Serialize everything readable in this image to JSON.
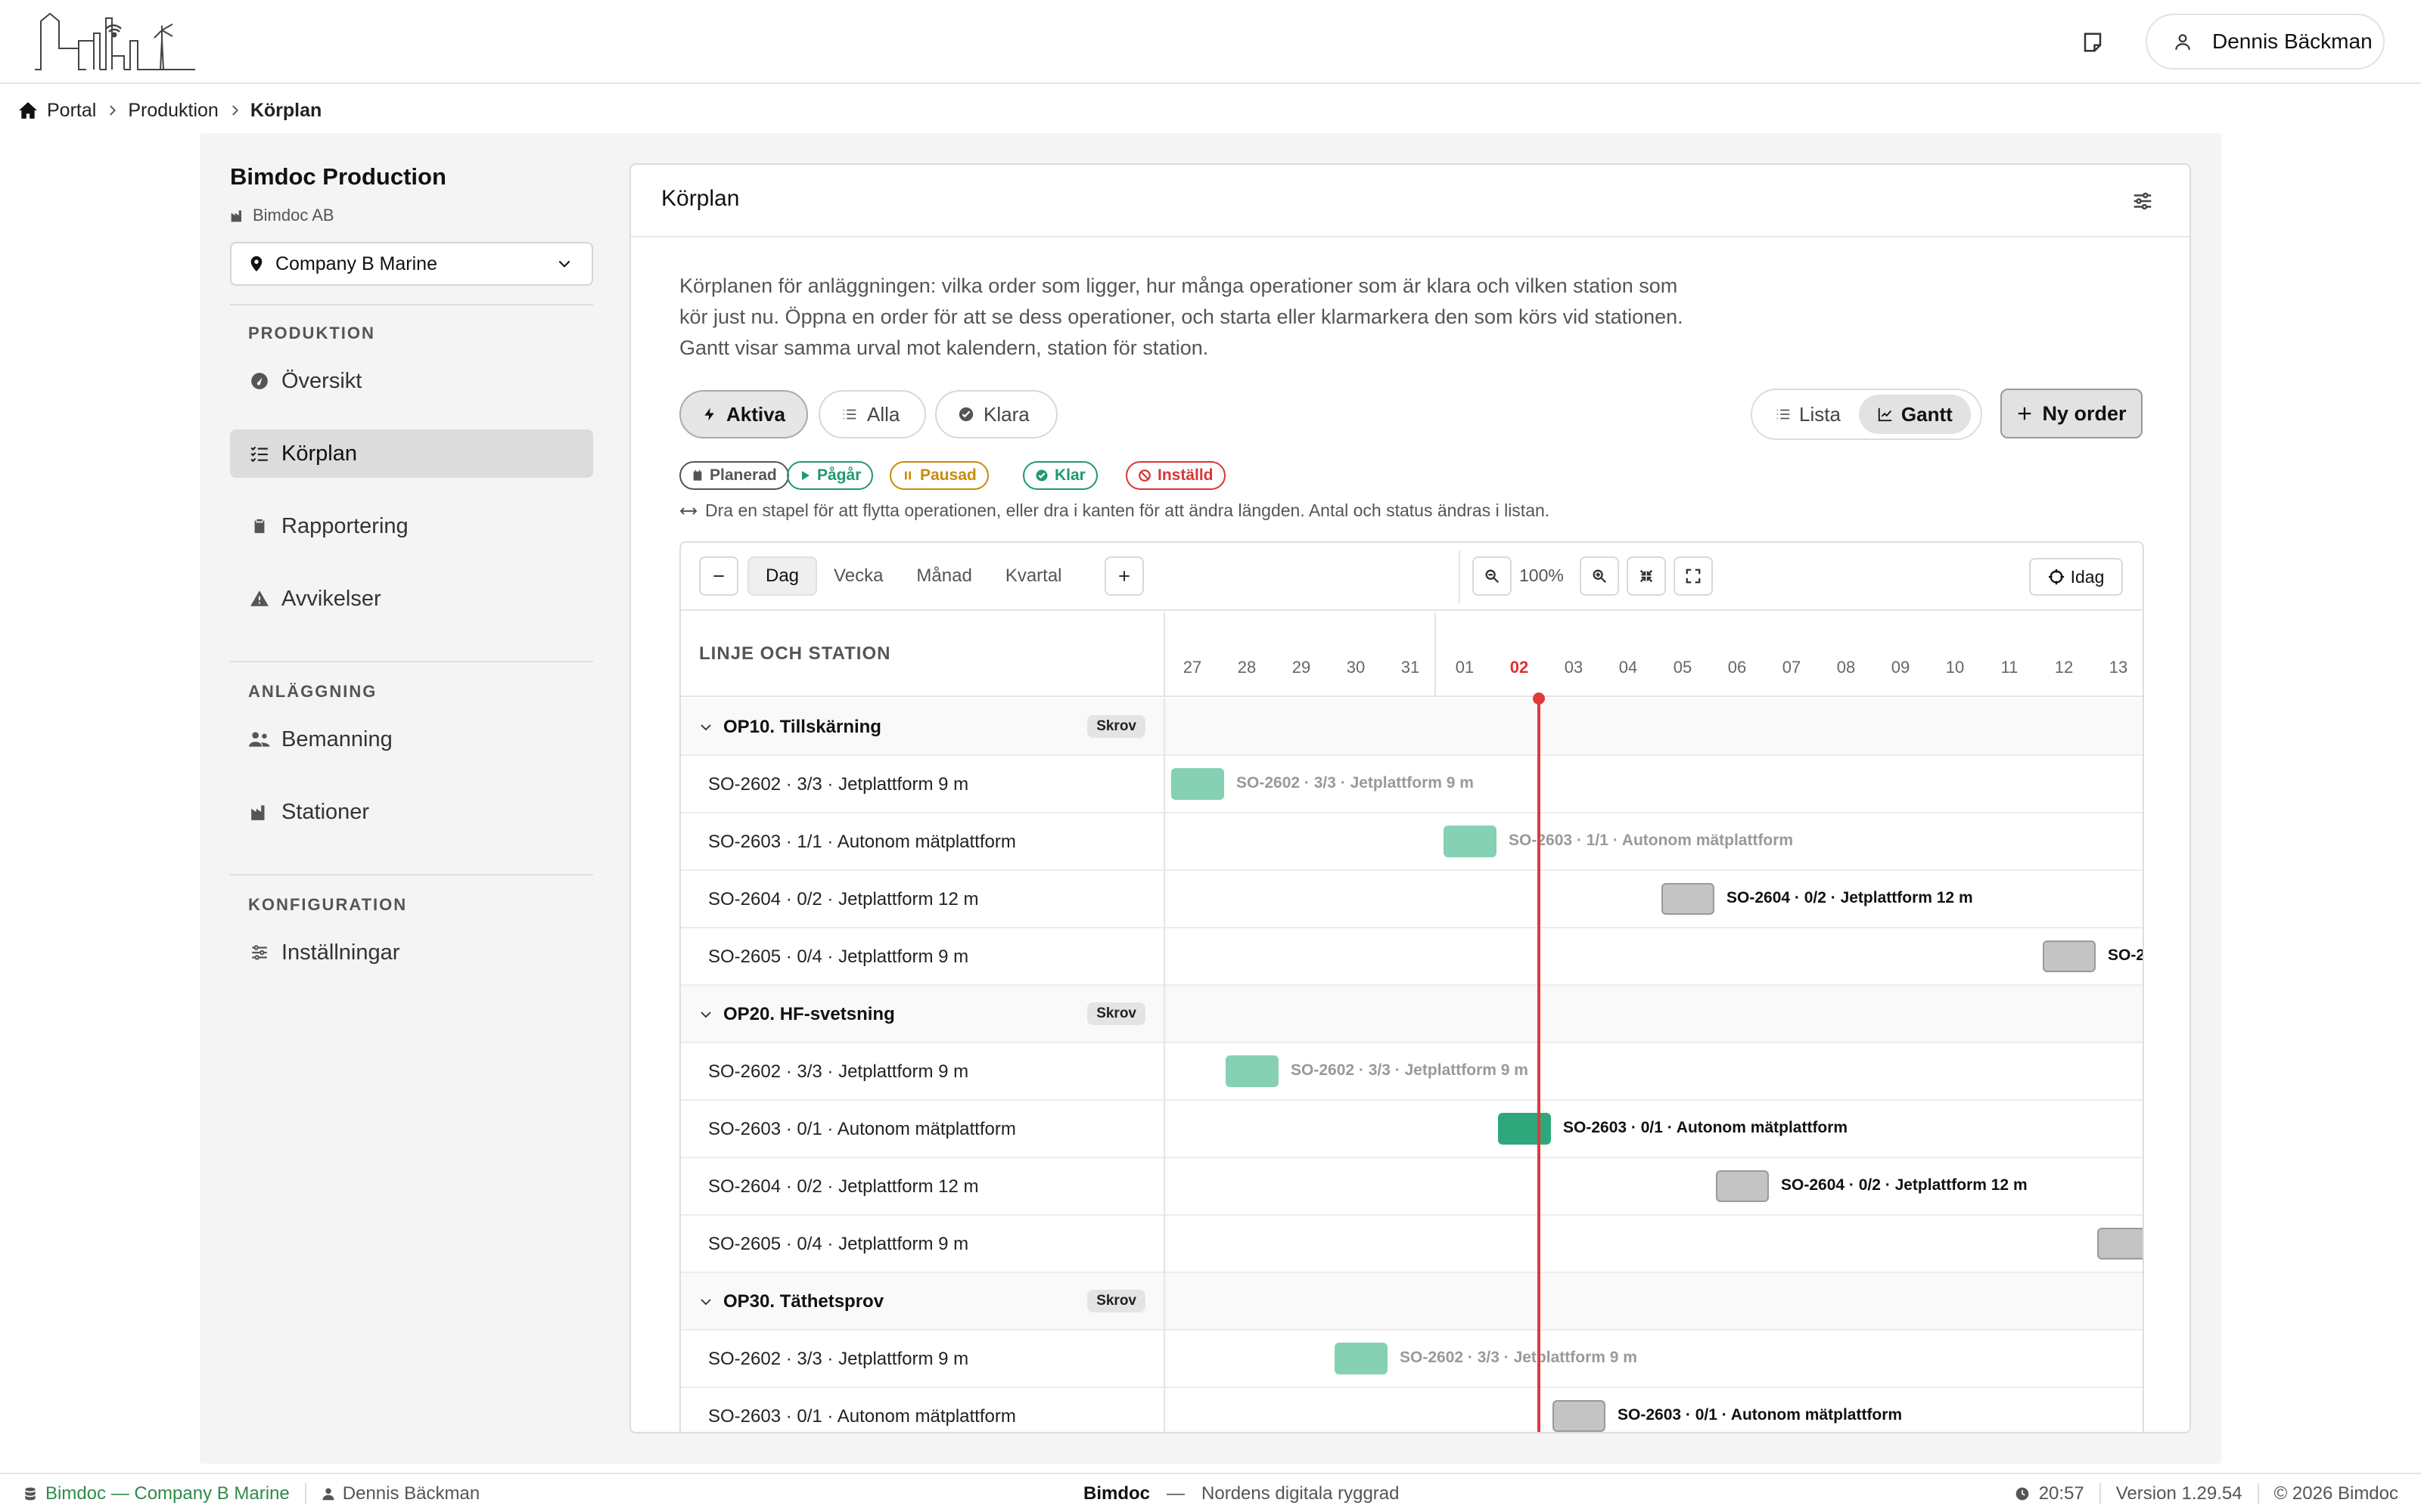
{
  "header": {
    "user_name": "Dennis Bäckman"
  },
  "breadcrumb": {
    "items": [
      "Portal",
      "Produktion",
      "Körplan"
    ]
  },
  "sidebar": {
    "org_title": "Bimdoc Production",
    "org_company": "Bimdoc AB",
    "site_selected": "Company B Marine",
    "sections": [
      {
        "label": "PRODUKTION",
        "items": [
          "Översikt",
          "Körplan",
          "Rapportering",
          "Avvikelser"
        ]
      },
      {
        "label": "ANLÄGGNING",
        "items": [
          "Bemanning",
          "Stationer"
        ]
      },
      {
        "label": "KONFIGURATION",
        "items": [
          "Inställningar"
        ]
      }
    ],
    "active_item": "Körplan"
  },
  "panel": {
    "title": "Körplan",
    "description": "Körplanen för anläggningen: vilka order som ligger, hur många operationer som är klara och vilken station som kör just nu. Öppna en order för att se dess operationer, och starta eller klarmarkera den som körs vid stationen. Gantt visar samma urval mot kalendern, station för station.",
    "filters": [
      "Aktiva",
      "Alla",
      "Klara"
    ],
    "active_filter": "Aktiva",
    "views": [
      "Lista",
      "Gantt"
    ],
    "active_view": "Gantt",
    "new_order_label": "Ny order",
    "legend": [
      {
        "label": "Planerad",
        "color": "#555555"
      },
      {
        "label": "Pågår",
        "color": "#1f9a6c"
      },
      {
        "label": "Pausad",
        "color": "#c98a0b"
      },
      {
        "label": "Klar",
        "color": "#1f9a6c"
      },
      {
        "label": "Inställd",
        "color": "#d93636"
      }
    ],
    "hint": "Dra en stapel för att flytta operationen, eller dra i kanten för att ändra längden. Antal och status ändras i listan."
  },
  "gantt": {
    "scales": [
      "Dag",
      "Vecka",
      "Månad",
      "Kvartal"
    ],
    "active_scale": "Dag",
    "zoom": "100%",
    "today_label": "Idag",
    "column_header": "LINJE OCH STATION",
    "days": [
      "27",
      "28",
      "29",
      "30",
      "31",
      "01",
      "02",
      "03",
      "04",
      "05",
      "06",
      "07",
      "08",
      "09",
      "10",
      "11",
      "12",
      "13"
    ],
    "today_index": 6,
    "groups": [
      {
        "name": "OP10. Tillskärning",
        "badge": "Skrov",
        "rows": [
          {
            "label": "SO-2602 · 3/3 · Jetplattform 9 m",
            "status": "done",
            "start": 0,
            "len": 1
          },
          {
            "label": "SO-2603 · 1/1 · Autonom mätplattform",
            "status": "done",
            "start": 5,
            "len": 1
          },
          {
            "label": "SO-2604 · 0/2 · Jetplattform 12 m",
            "status": "planned",
            "start": 9,
            "len": 1
          },
          {
            "label": "SO-2605 · 0/4 · Jetplattform 9 m",
            "status": "planned",
            "start": 16,
            "len": 1
          }
        ]
      },
      {
        "name": "OP20. HF-svetsning",
        "badge": "Skrov",
        "rows": [
          {
            "label": "SO-2602 · 3/3 · Jetplattform 9 m",
            "status": "done",
            "start": 1,
            "len": 1
          },
          {
            "label": "SO-2603 · 0/1 · Autonom mätplattform",
            "status": "running",
            "start": 6,
            "len": 1
          },
          {
            "label": "SO-2604 · 0/2 · Jetplattform 12 m",
            "status": "planned",
            "start": 10,
            "len": 1
          },
          {
            "label": "SO-2605 · 0/4 · Jetplattform 9 m",
            "status": "planned",
            "start": 17,
            "len": 1
          }
        ]
      },
      {
        "name": "OP30. Täthetsprov",
        "badge": "Skrov",
        "rows": [
          {
            "label": "SO-2602 · 3/3 · Jetplattform 9 m",
            "status": "done",
            "start": 3,
            "len": 1
          },
          {
            "label": "SO-2603 · 0/1 · Autonom mätplattform",
            "status": "planned",
            "start": 7,
            "len": 1
          }
        ]
      }
    ]
  },
  "footer": {
    "brand": "Bimdoc — Company B Marine",
    "user": "Dennis Bäckman",
    "center_brand": "Bimdoc",
    "tagline": "Nordens digitala ryggrad",
    "time": "20:57",
    "version": "Version 1.29.54",
    "copyright": "© 2026 Bimdoc"
  }
}
